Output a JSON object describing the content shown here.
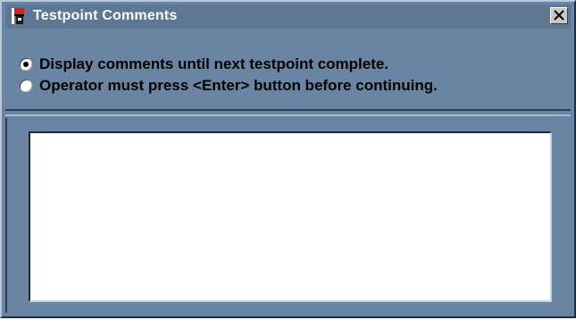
{
  "window": {
    "title": "Testpoint Comments",
    "icon": "testpoint-app-icon",
    "close_icon": "close-icon"
  },
  "options": [
    {
      "label": "Display comments until next testpoint complete.",
      "selected": true
    },
    {
      "label": "Operator must press <Enter> button before continuing.",
      "selected": false
    }
  ],
  "comments": {
    "value": ""
  },
  "colors": {
    "window_bg": "#6a85a3",
    "titlebar_bg": "#5e7793",
    "title_text": "#ffffff"
  }
}
